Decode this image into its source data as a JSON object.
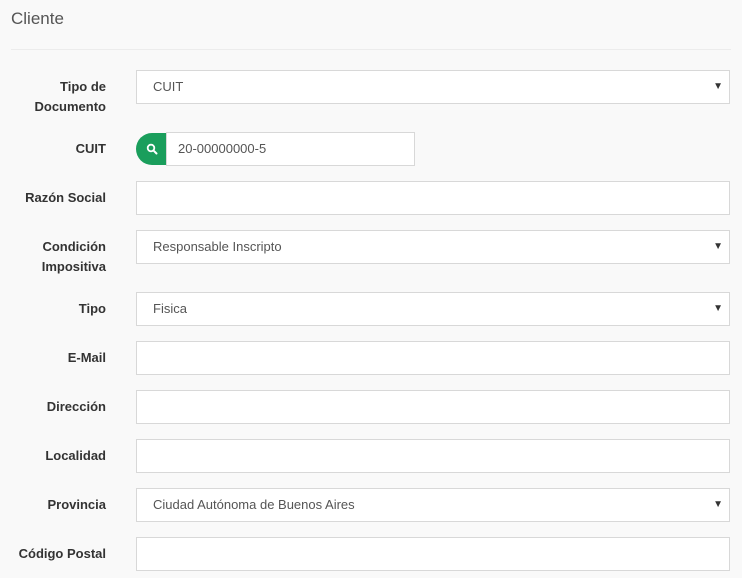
{
  "panel": {
    "title": "Cliente"
  },
  "colors": {
    "accent": "#1a9e5c",
    "border": "#d8d8d8",
    "background": "#f9f9f9"
  },
  "form": {
    "tipo_documento": {
      "label_line1": "Tipo de",
      "label_line2": "Documento",
      "value": "CUIT"
    },
    "cuit": {
      "label": "CUIT",
      "value": "20-00000000-5",
      "button_icon": "search-icon"
    },
    "razon_social": {
      "label": "Razón Social",
      "value": ""
    },
    "condicion_impositiva": {
      "label_line1": "Condición",
      "label_line2": "Impositiva",
      "value": "Responsable Inscripto"
    },
    "tipo": {
      "label": "Tipo",
      "value": "Fisica"
    },
    "email": {
      "label": "E-Mail",
      "value": ""
    },
    "direccion": {
      "label": "Dirección",
      "value": ""
    },
    "localidad": {
      "label": "Localidad",
      "value": ""
    },
    "provincia": {
      "label": "Provincia",
      "value": "Ciudad Autónoma de Buenos Aires"
    },
    "codigo_postal": {
      "label": "Código Postal",
      "value": ""
    }
  },
  "select_caret": "▼"
}
